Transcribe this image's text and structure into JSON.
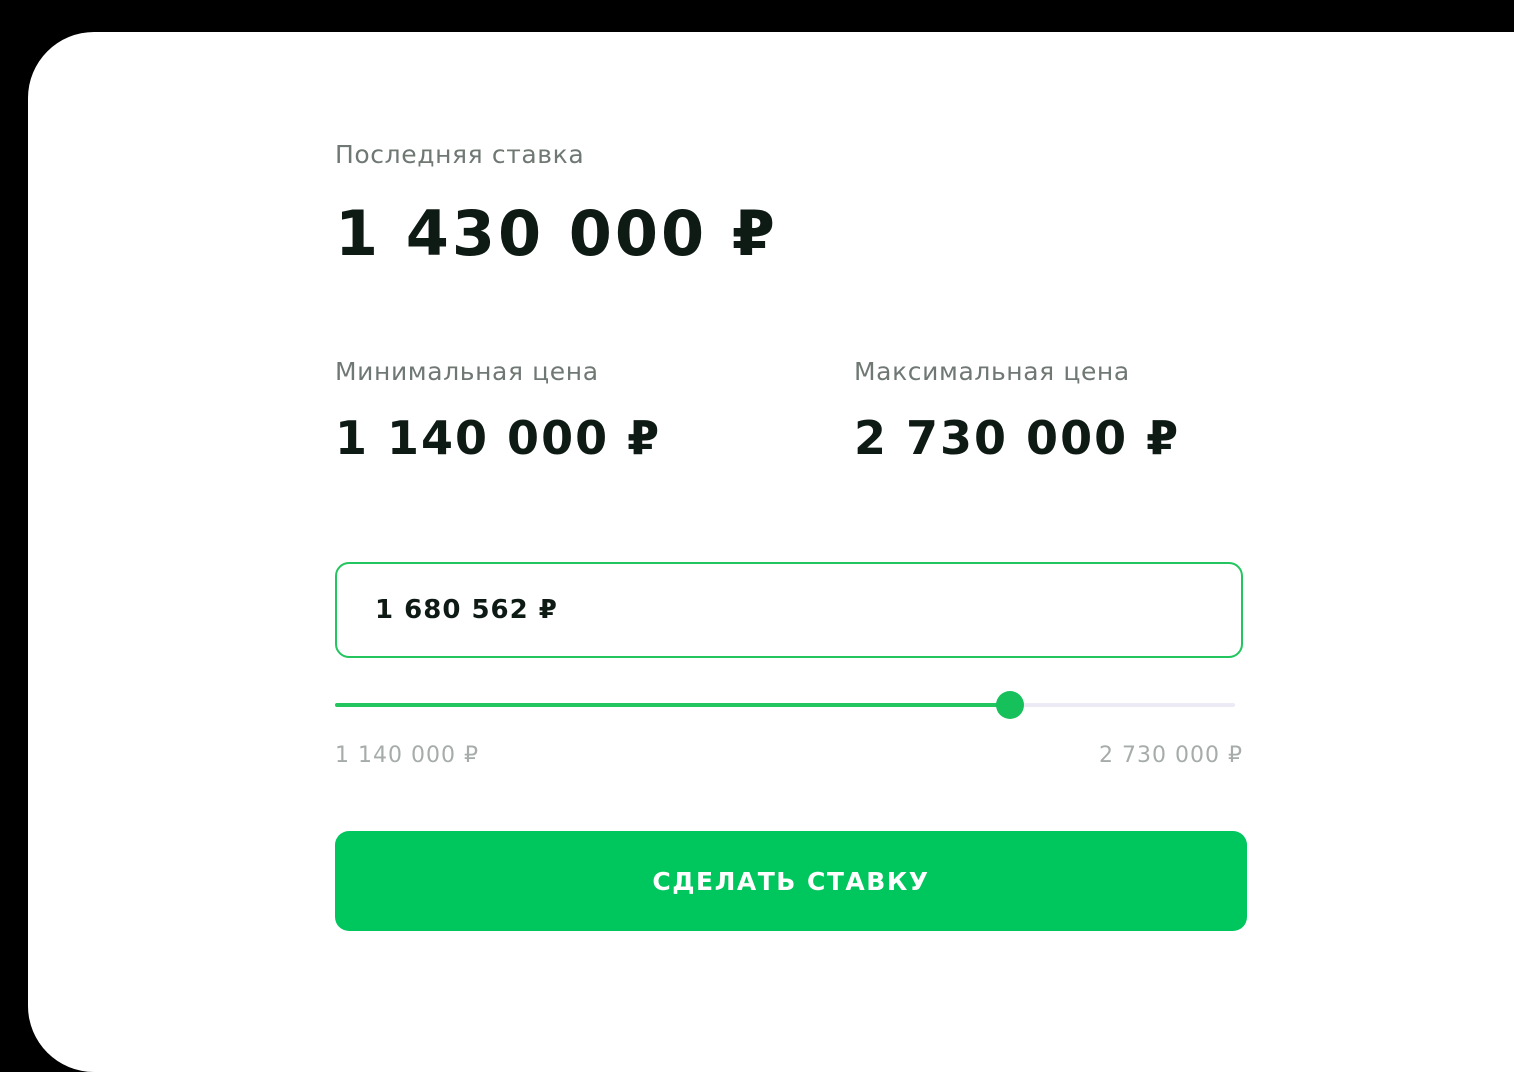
{
  "bid_panel": {
    "last_bid_label": "Последняя ставка",
    "last_bid_value": "1 430 000 ₽",
    "min_price_label": "Минимальная цена",
    "min_price_value": "1 140 000 ₽",
    "max_price_label": "Максимальная цена",
    "max_price_value": "2 730 000 ₽",
    "input_value": "1 680 562 ₽",
    "slider": {
      "fraction": 0.75,
      "min_label": "1 140 000 ₽",
      "max_label": "2 730 000 ₽"
    },
    "submit_label": "СДЕЛАТЬ СТАВКУ"
  },
  "colors": {
    "accent": "#00c65e",
    "background": "#000000",
    "card": "#ffffff",
    "text": "#0e1a14",
    "muted": "#6f7873",
    "track": "#eceaf4"
  }
}
